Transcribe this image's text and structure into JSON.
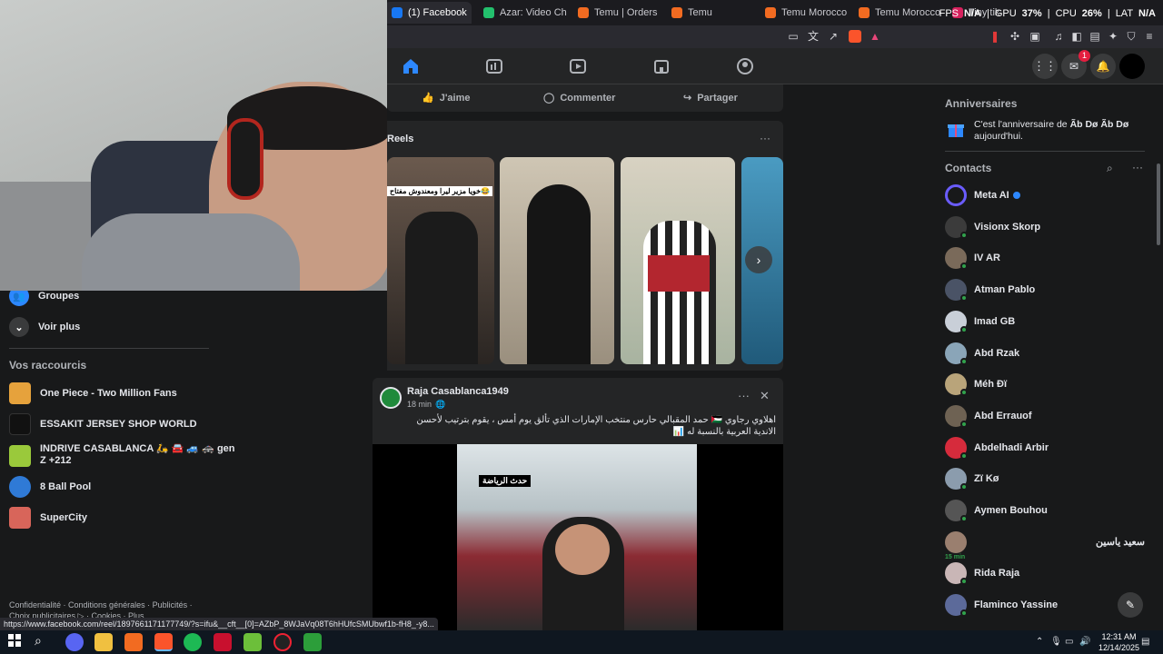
{
  "browser": {
    "tabs": [
      {
        "label": "(1) Facebook",
        "color": "#1877f2",
        "active": true
      },
      {
        "label": "Azar: Video Chat",
        "color": "#23c06d"
      },
      {
        "label": "Temu | Orders",
        "color": "#f26b21"
      },
      {
        "label": "Temu",
        "color": "#f26b21"
      },
      {
        "label": "Temu Morocco | Ex",
        "color": "#f26b21"
      },
      {
        "label": "Temu Morocco | ma",
        "color": "#f26b21"
      },
      {
        "label": "Tiny tik games",
        "color": "#d6215d"
      }
    ],
    "tab_close": "✕",
    "perf": {
      "fps_label": "FPS",
      "fps_value": "N/A",
      "gpu_label": "GPU",
      "gpu_value": "37",
      "gpu_unit": "%",
      "cpu_label": "CPU",
      "cpu_value": "26",
      "cpu_unit": "%",
      "lat_label": "LAT",
      "lat_value": "N/A"
    }
  },
  "facebook": {
    "notif_badge": "1",
    "post_actions": {
      "like": "J'aime",
      "comment": "Commenter",
      "share": "Partager"
    },
    "reels": {
      "title": "Reels",
      "more": "···",
      "reel1_caption": "خويا مزير ليرا ومعندوش مفتاح😂"
    },
    "post": {
      "author": "Raja Casablanca1949",
      "time": "18 min",
      "text": "اهلاوي رجاوي 🇵🇸 حمد المقبالي حارس منتخب الإمارات الذي تألق يوم أمس ، يقوم بترتيب لأحسن الاندية العربية بالنسبة له 📊",
      "video_caption": "حدث الرياضة",
      "more": "···",
      "close": "✕"
    }
  },
  "sidebar": {
    "items": [
      {
        "label": "Groupes"
      },
      {
        "label": "Voir plus"
      }
    ],
    "shortcuts_title": "Vos raccourcis",
    "shortcuts": [
      {
        "label": "One Piece - Two Million Fans",
        "color": "#e6a23c"
      },
      {
        "label": "ESSAKIT JERSEY SHOP WORLD",
        "color": "#111111"
      },
      {
        "label": "INDRIVE CASABLANCA 🛵 🚘 🚙 🚓 gen",
        "label2": "Z +212",
        "color": "#9ac93b"
      },
      {
        "label": "8 Ball Pool",
        "color": "#2f7ad6"
      },
      {
        "label": "SuperCity",
        "color": "#d8655a"
      }
    ],
    "footer_line1": "Confidentialité · Conditions générales · Publicités ·",
    "footer_line2": "Choix publicitaires ▷ · Cookies · Plus"
  },
  "right_rail": {
    "birthdays_title": "Anniversaires",
    "birthday_text_pre": "C'est l'anniversaire de ",
    "birthday_name": "Ãb Dø Ãb Dø",
    "birthday_text_post": " aujourd'hui.",
    "contacts_title": "Contacts",
    "contacts": [
      {
        "name": "Meta AI",
        "color": "#6a5cff",
        "verified": true
      },
      {
        "name": "Visionx Skorp",
        "color": "#3b3b3b",
        "online": true
      },
      {
        "name": "IV AR",
        "color": "#7a6a5a",
        "online": true
      },
      {
        "name": "Atman Pablo",
        "color": "#4a5366",
        "online": true
      },
      {
        "name": "Imad GB",
        "color": "#c9cfd8",
        "online": true
      },
      {
        "name": "Abd Rzak",
        "color": "#8aa5b8",
        "online": true
      },
      {
        "name": "Méh Đï",
        "color": "#b9a47a",
        "online": true
      },
      {
        "name": "Abd Errauof",
        "color": "#6e6253",
        "online": true
      },
      {
        "name": "Abdelhadi Arbir",
        "color": "#d62b3c",
        "online": true
      },
      {
        "name": "Zï Kø",
        "color": "#8b9cad",
        "online": true
      },
      {
        "name": "Aymen Bouhou",
        "color": "#555555",
        "online": true
      },
      {
        "name": "سعيد ياسين",
        "color": "#9a7f6f",
        "status": "15 min"
      },
      {
        "name": "Rida Raja",
        "color": "#c9b6b6",
        "online": true
      },
      {
        "name": "Flaminco Yassine",
        "color": "#5c6a9a",
        "online": true
      }
    ]
  },
  "status_url": "https://www.facebook.com/reel/1897661171177749/?s=ifu&__cft__[0]=AZbP_8WJaVq08T6hHUfcSMUbwf1b-fH8_-y8...",
  "taskbar": {
    "time": "12:31 AM",
    "date": "12/14/2025"
  }
}
